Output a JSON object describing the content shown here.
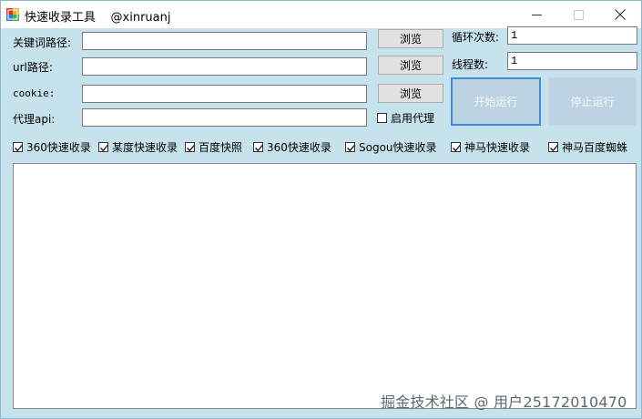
{
  "window": {
    "title": "快速收录工具    @xinruanj",
    "minimize_label": "—",
    "maximize_label": "☐",
    "close_label": "✕"
  },
  "fields": {
    "keyword_path": {
      "label": "关键词路径:",
      "value": ""
    },
    "url_path": {
      "label": "url路径:",
      "value": ""
    },
    "cookie": {
      "label": "cookie:",
      "value": ""
    },
    "proxy_api": {
      "label": "代理api:",
      "value": ""
    },
    "loop_count": {
      "label": "循环次数:",
      "value": "1"
    },
    "thread_count": {
      "label": "线程数:",
      "value": "1"
    }
  },
  "buttons": {
    "browse_keyword": "浏览",
    "browse_url": "浏览",
    "browse_cookie": "浏览",
    "start": "开始运行",
    "stop": "停止运行"
  },
  "proxy_checkbox": {
    "label": "启用代理",
    "checked": false
  },
  "engines": [
    {
      "label": "360快速收录",
      "checked": true
    },
    {
      "label": "某度快速收录",
      "checked": true
    },
    {
      "label": "百度快照",
      "checked": true
    },
    {
      "label": "360快速收录",
      "checked": true
    },
    {
      "label": "Sogou快速收录",
      "checked": true
    },
    {
      "label": "神马快速收录",
      "checked": true
    },
    {
      "label": "神马百度蜘蛛",
      "checked": true
    }
  ],
  "log": {
    "text": ""
  },
  "watermark": "掘金技术社区 @ 用户25172010470"
}
